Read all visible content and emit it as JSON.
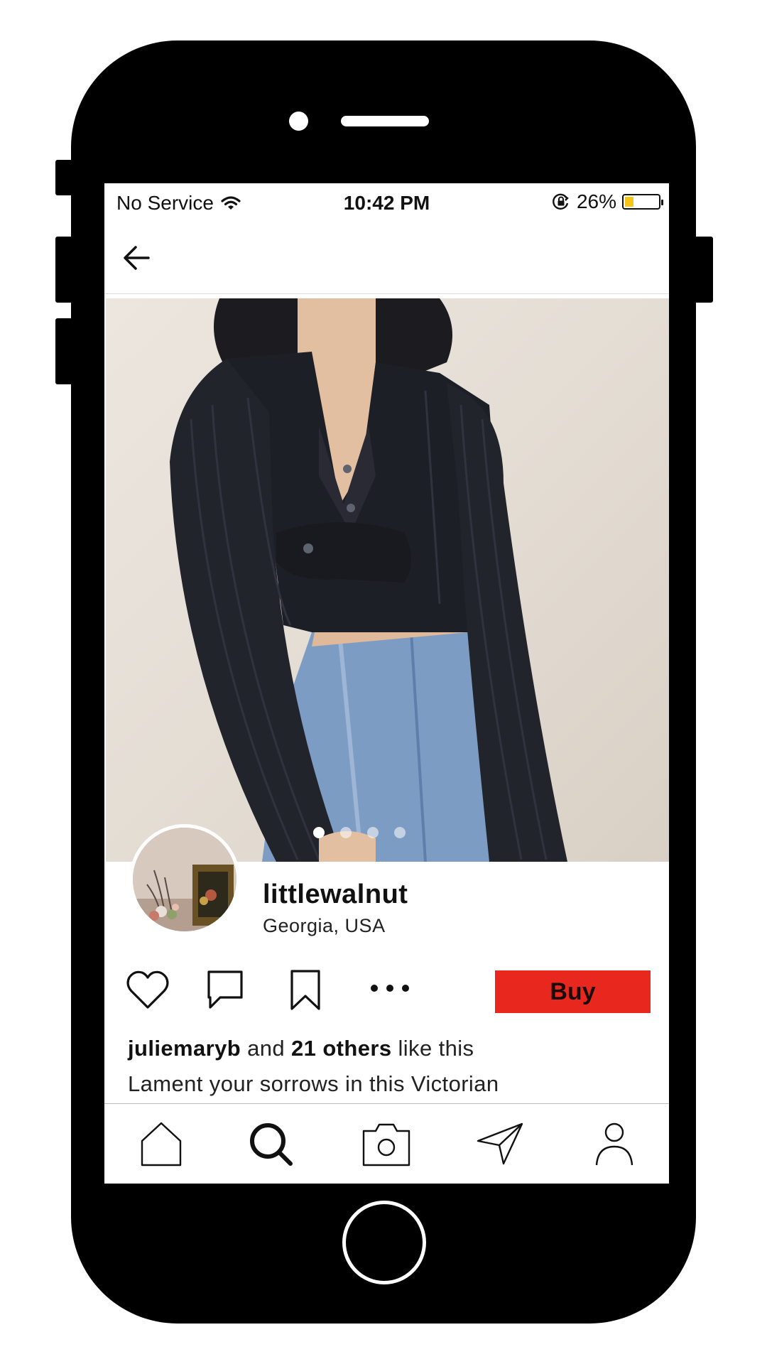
{
  "status_bar": {
    "carrier": "No Service",
    "time": "10:42 PM",
    "battery_percent": "26%",
    "battery_level": 0.26,
    "battery_color": "#f5c518"
  },
  "nav": {
    "back_icon": "arrow-left-icon"
  },
  "photo": {
    "description_icon": "product-photo",
    "carousel_total": 4,
    "carousel_active": 1
  },
  "profile": {
    "username": "littlewalnut",
    "location": "Georgia, USA"
  },
  "actions": {
    "like_icon": "heart-icon",
    "comment_icon": "comment-icon",
    "save_icon": "bookmark-icon",
    "more_icon": "more-icon",
    "buy_label": "Buy",
    "buy_color": "#e8281f"
  },
  "likes": {
    "liker": "juliemaryb",
    "connector": "and",
    "others": "21 others",
    "suffix": "like this"
  },
  "caption": "Lament your sorrows in this Victorian",
  "tab_bar": {
    "items": [
      "home-icon",
      "search-icon",
      "camera-icon",
      "send-icon",
      "profile-icon"
    ]
  }
}
